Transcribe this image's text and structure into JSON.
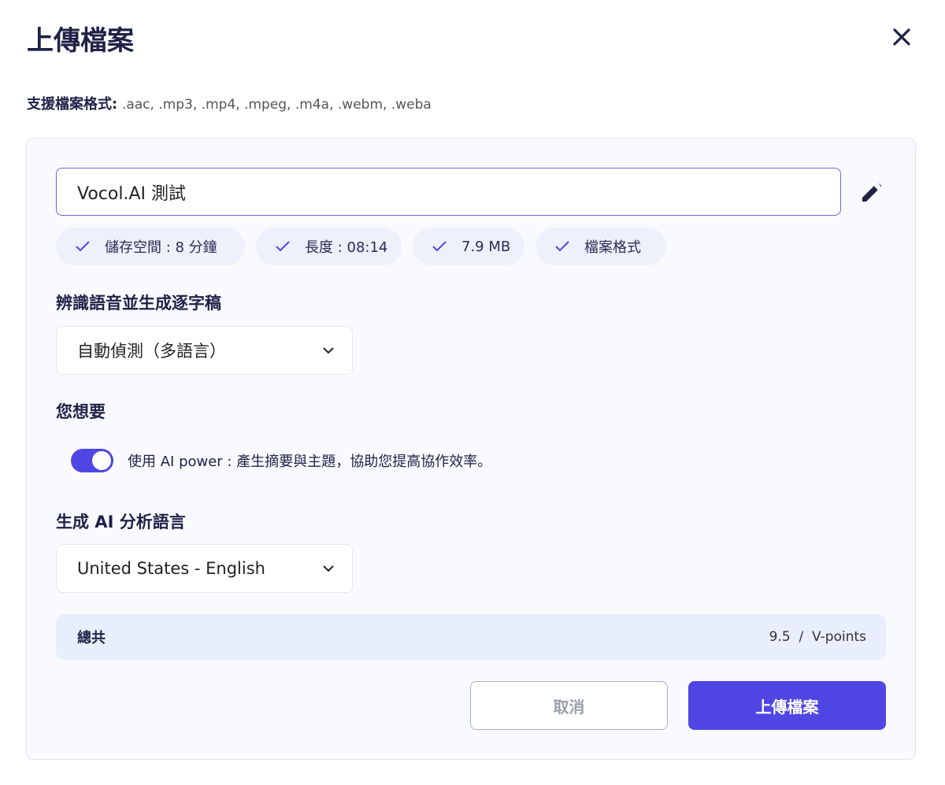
{
  "dialog": {
    "title": "上傳檔案",
    "close_icon": "close-icon"
  },
  "formats": {
    "label": "支援檔案格式:",
    "value": ".aac, .mp3, .mp4, .mpeg, .m4a, .webm, .weba"
  },
  "file": {
    "name": "Vocol.AI 測試"
  },
  "chips": [
    {
      "label": "儲存空間 : 8 分鐘"
    },
    {
      "label": "長度 : 08:14"
    },
    {
      "label": "7.9 MB"
    },
    {
      "label": "檔案格式"
    }
  ],
  "transcription": {
    "heading": "辨識語音並生成逐字稿",
    "selected": "自動偵測（多語言）"
  },
  "options": {
    "heading": "您想要",
    "ai_power_label": "使用 AI power : 產生摘要與主題，協助您提高協作效率。",
    "ai_power_enabled": true
  },
  "ai_language": {
    "heading": "生成 AI 分析語言",
    "selected": "United States - English"
  },
  "total": {
    "label": "總共",
    "value": "9.5  /  V-points"
  },
  "buttons": {
    "cancel": "取消",
    "upload": "上傳檔案"
  },
  "colors": {
    "accent": "#5046e4",
    "panel_bg": "#f9fafe",
    "total_bg": "#e8eefb"
  }
}
